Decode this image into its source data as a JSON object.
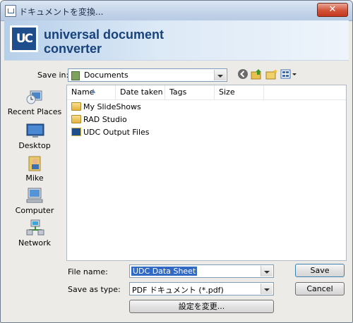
{
  "window": {
    "title": "ドキュメントを変換...",
    "close_label": "✕"
  },
  "banner": {
    "logo_text": "UC",
    "brand_line1": "universal document",
    "brand_line2": "converter"
  },
  "location": {
    "label": "Save in:",
    "value": "Documents"
  },
  "places": [
    {
      "label": "Recent Places",
      "icon": "recent-places-icon"
    },
    {
      "label": "Desktop",
      "icon": "desktop-icon"
    },
    {
      "label": "Mike",
      "icon": "user-folder-icon"
    },
    {
      "label": "Computer",
      "icon": "computer-icon"
    },
    {
      "label": "Network",
      "icon": "network-icon"
    }
  ],
  "columns": [
    "Name",
    "Date taken",
    "Tags",
    "Size"
  ],
  "files": [
    {
      "name": "My SlideShows",
      "icon": "folder-icon"
    },
    {
      "name": "RAD Studio",
      "icon": "folder-icon"
    },
    {
      "name": "UDC Output Files",
      "icon": "udc-folder-icon"
    }
  ],
  "form": {
    "filename_label": "File name:",
    "filename_value": "UDC Data Sheet",
    "type_label": "Save as type:",
    "type_value": "PDF ドキュメント (*.pdf)",
    "settings_label": "設定を変更..."
  },
  "buttons": {
    "save": "Save",
    "cancel": "Cancel"
  }
}
